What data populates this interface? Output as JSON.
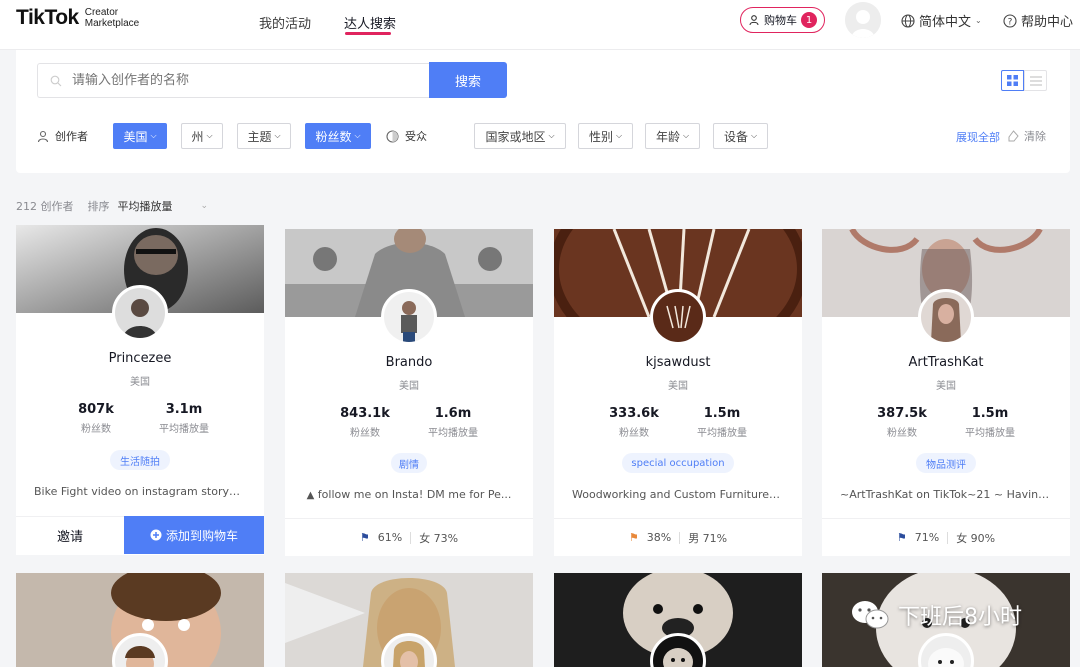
{
  "header": {
    "logo_main": "TikTok",
    "logo_sub_1": "Creator",
    "logo_sub_2": "Marketplace",
    "nav": [
      {
        "label": "我的活动"
      },
      {
        "label": "达人搜索"
      }
    ],
    "cart_label": "购物车",
    "cart_count": "1",
    "language": "简体中文",
    "help": "帮助中心"
  },
  "search": {
    "placeholder": "请输入创作者的名称",
    "button": "搜索"
  },
  "filters": {
    "creator_label": "创作者",
    "audience_label": "受众",
    "creator_chips": [
      {
        "label": "美国",
        "active": true
      },
      {
        "label": "州",
        "active": false
      },
      {
        "label": "主题",
        "active": false
      },
      {
        "label": "粉丝数",
        "active": true
      }
    ],
    "audience_chips": [
      {
        "label": "国家或地区"
      },
      {
        "label": "性别"
      },
      {
        "label": "年龄"
      },
      {
        "label": "设备"
      }
    ],
    "expand_all": "展现全部",
    "clear": "清除"
  },
  "results": {
    "count": "212 创作者",
    "sort_label": "排序",
    "sort_value": "平均播放量"
  },
  "creators": [
    {
      "name": "Princezee",
      "country": "美国",
      "followers": "807k",
      "followers_label": "粉丝数",
      "avg_views": "3.1m",
      "avg_views_label": "平均播放量",
      "tag": "生活随拍",
      "bio": "Bike Fight video on instagram storyM...",
      "invite": "邀请",
      "add_to_cart": "添加到购物车"
    },
    {
      "name": "Brando",
      "country": "美国",
      "followers": "843.1k",
      "followers_label": "粉丝数",
      "avg_views": "1.6m",
      "avg_views_label": "平均播放量",
      "tag": "剧情",
      "bio": "follow me on Insta! DM me for Pe...",
      "audience_country_pct": "61%",
      "audience_gender": "女 73%"
    },
    {
      "name": "kjsawdust",
      "country": "美国",
      "followers": "333.6k",
      "followers_label": "粉丝数",
      "avg_views": "1.5m",
      "avg_views_label": "平均播放量",
      "tag": "special occupation",
      "bio": "Woodworking and Custom FurnitureF...",
      "audience_country_pct": "38%",
      "audience_gender": "男 71%"
    },
    {
      "name": "ArtTrashKat",
      "country": "美国",
      "followers": "387.5k",
      "followers_label": "粉丝数",
      "avg_views": "1.5m",
      "avg_views_label": "平均播放量",
      "tag": "物品测评",
      "bio": "~ArtTrashKat on TikTok~21 ~ Having ...",
      "audience_country_pct": "71%",
      "audience_gender": "女 90%"
    }
  ],
  "watermark": "下班后8小时",
  "colors": {
    "accent": "#4f7ef6",
    "brand": "#e0245e",
    "tag_bg": "#eef3fe"
  }
}
